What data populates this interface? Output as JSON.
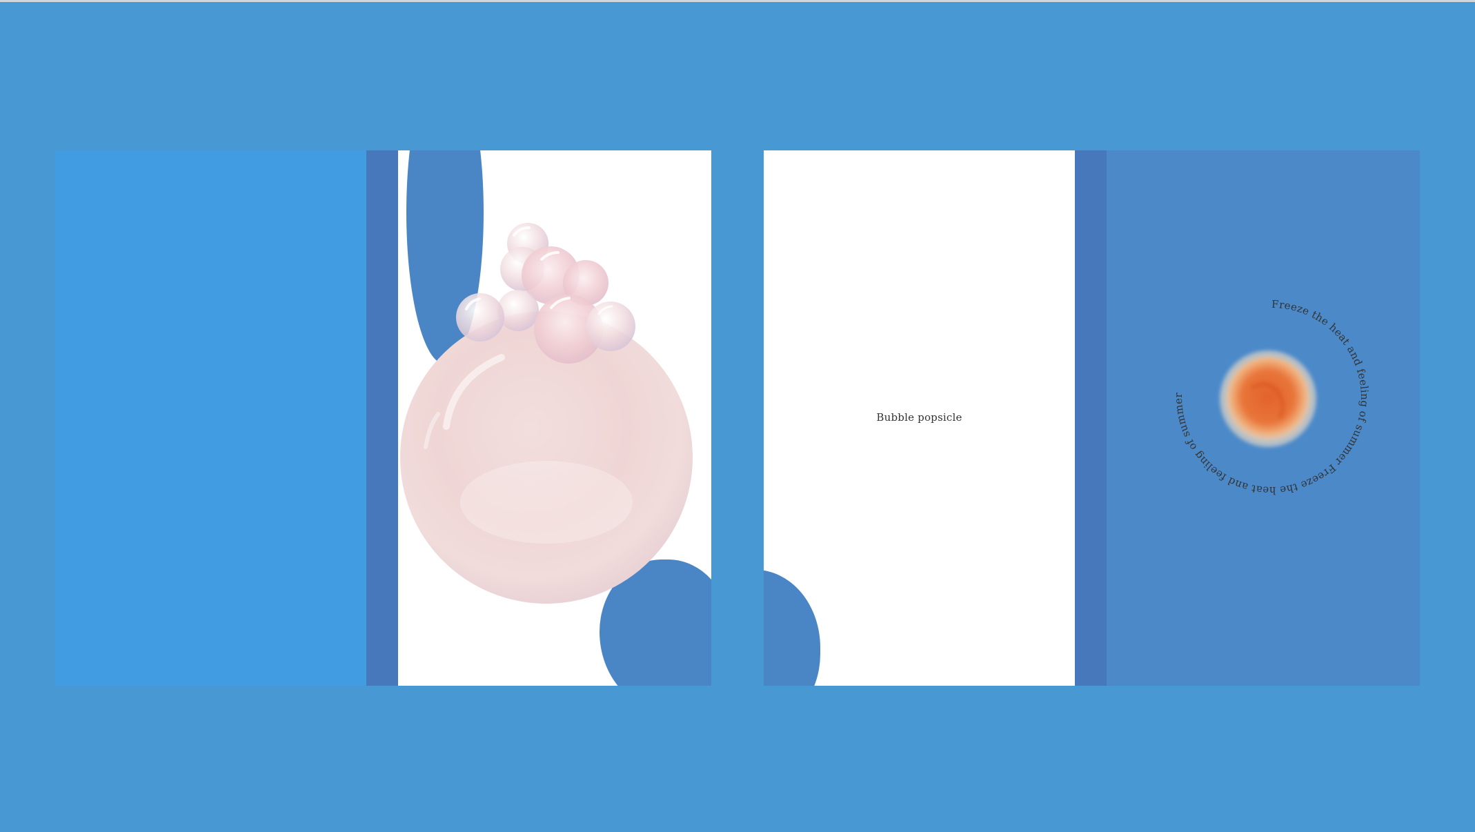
{
  "colors": {
    "background": "#4898d4",
    "page_blue": "#429ce2",
    "spine": "#4678bb",
    "cover": "#4b89c9",
    "blob": "#4a86c6",
    "page_white": "#ffffff",
    "bubble_pink": "#f0d6d6",
    "orange": "#e66a2f"
  },
  "illustration": {
    "bubble_icon": "bubble-cluster-illustration",
    "orange_icon": "orange-ball-illustration"
  },
  "title_page": {
    "title": "Bubble popsicle"
  },
  "cover": {
    "ring_text": "Freeze the heat and feeling of summer Freeze the heat and feeling of summer"
  }
}
